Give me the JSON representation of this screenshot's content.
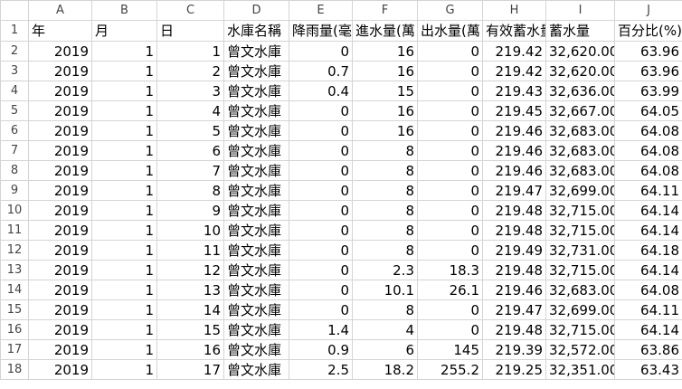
{
  "columns": [
    "A",
    "B",
    "C",
    "D",
    "E",
    "F",
    "G",
    "H",
    "I",
    "J"
  ],
  "header": [
    "年",
    "月",
    "日",
    "水庫名稱",
    "降雨量(毫",
    "進水量(萬",
    "出水量(萬",
    "有效蓄水量",
    "蓄水量",
    "百分比(%)"
  ],
  "rows": [
    [
      "2019",
      "1",
      "1",
      "曾文水庫",
      "0",
      "16",
      "0",
      "219.42",
      "32,620.00",
      "63.96"
    ],
    [
      "2019",
      "1",
      "2",
      "曾文水庫",
      "0.7",
      "16",
      "0",
      "219.42",
      "32,620.00",
      "63.96"
    ],
    [
      "2019",
      "1",
      "3",
      "曾文水庫",
      "0.4",
      "15",
      "0",
      "219.43",
      "32,636.00",
      "63.99"
    ],
    [
      "2019",
      "1",
      "4",
      "曾文水庫",
      "0",
      "16",
      "0",
      "219.45",
      "32,667.00",
      "64.05"
    ],
    [
      "2019",
      "1",
      "5",
      "曾文水庫",
      "0",
      "16",
      "0",
      "219.46",
      "32,683.00",
      "64.08"
    ],
    [
      "2019",
      "1",
      "6",
      "曾文水庫",
      "0",
      "8",
      "0",
      "219.46",
      "32,683.00",
      "64.08"
    ],
    [
      "2019",
      "1",
      "7",
      "曾文水庫",
      "0",
      "8",
      "0",
      "219.46",
      "32,683.00",
      "64.08"
    ],
    [
      "2019",
      "1",
      "8",
      "曾文水庫",
      "0",
      "8",
      "0",
      "219.47",
      "32,699.00",
      "64.11"
    ],
    [
      "2019",
      "1",
      "9",
      "曾文水庫",
      "0",
      "8",
      "0",
      "219.48",
      "32,715.00",
      "64.14"
    ],
    [
      "2019",
      "1",
      "10",
      "曾文水庫",
      "0",
      "8",
      "0",
      "219.48",
      "32,715.00",
      "64.14"
    ],
    [
      "2019",
      "1",
      "11",
      "曾文水庫",
      "0",
      "8",
      "0",
      "219.49",
      "32,731.00",
      "64.18"
    ],
    [
      "2019",
      "1",
      "12",
      "曾文水庫",
      "0",
      "2.3",
      "18.3",
      "219.48",
      "32,715.00",
      "64.14"
    ],
    [
      "2019",
      "1",
      "13",
      "曾文水庫",
      "0",
      "10.1",
      "26.1",
      "219.46",
      "32,683.00",
      "64.08"
    ],
    [
      "2019",
      "1",
      "14",
      "曾文水庫",
      "0",
      "8",
      "0",
      "219.47",
      "32,699.00",
      "64.11"
    ],
    [
      "2019",
      "1",
      "15",
      "曾文水庫",
      "1.4",
      "4",
      "0",
      "219.48",
      "32,715.00",
      "64.14"
    ],
    [
      "2019",
      "1",
      "16",
      "曾文水庫",
      "0.9",
      "6",
      "145",
      "219.39",
      "32,572.00",
      "63.86"
    ],
    [
      "2019",
      "1",
      "17",
      "曾文水庫",
      "2.5",
      "18.2",
      "255.2",
      "219.25",
      "32,351.00",
      "63.43"
    ]
  ]
}
